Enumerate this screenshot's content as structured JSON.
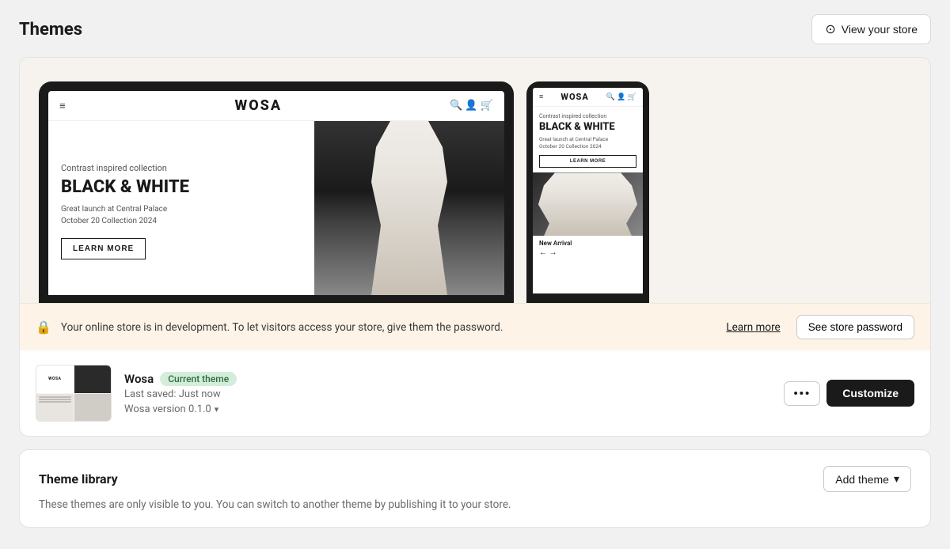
{
  "page": {
    "title": "Themes"
  },
  "header": {
    "view_store_label": "View your store"
  },
  "preview": {
    "tablet": {
      "brand": "WOSA",
      "subtitle": "Contrast inspired collection",
      "heading": "BLACK & WHITE",
      "desc_line1": "Great launch at Central Palace",
      "desc_line2": "October 20 Collection 2024",
      "cta": "LEARN MORE"
    },
    "phone": {
      "brand": "WOSA",
      "subtitle": "Contrast inspired collection",
      "heading": "BLACK & WHITE",
      "desc_line1": "Great launch at Central Palace",
      "desc_line2": "October 20 Collection 2024",
      "cta": "LEARN MORE",
      "new_arrival": "New Arrival"
    }
  },
  "password_bar": {
    "message": "Your online store is in development. To let visitors access your store, give them the password.",
    "learn_more": "Learn more",
    "see_password_btn": "See store password"
  },
  "theme": {
    "name": "Wosa",
    "badge": "Current theme",
    "saved": "Last saved: Just now",
    "version": "Wosa version 0.1.0",
    "more_icon": "•••",
    "customize_btn": "Customize"
  },
  "library": {
    "title": "Theme library",
    "description": "These themes are only visible to you. You can switch to another theme by publishing it to your store.",
    "add_theme_btn": "Add theme"
  }
}
